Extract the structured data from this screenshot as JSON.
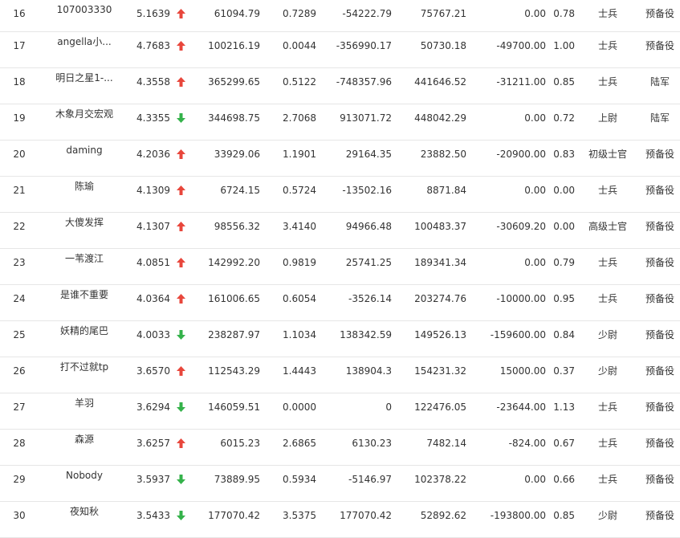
{
  "colors": {
    "up": "#e8463b",
    "down": "#34b24a",
    "text": "#333333",
    "divider": "#e6e6e6"
  },
  "rows": [
    {
      "rank": "16",
      "name": "107003330",
      "score": "5.1639",
      "trend": "up",
      "v1": "61094.79",
      "v2": "0.7289",
      "v3": "-54222.79",
      "v4": "75767.21",
      "v5": "0.00",
      "v6": "0.78",
      "military_rank": "士兵",
      "service": "预备役"
    },
    {
      "rank": "17",
      "name": "angella小...",
      "score": "4.7683",
      "trend": "up",
      "v1": "100216.19",
      "v2": "0.0044",
      "v3": "-356990.17",
      "v4": "50730.18",
      "v5": "-49700.00",
      "v6": "1.00",
      "military_rank": "士兵",
      "service": "预备役"
    },
    {
      "rank": "18",
      "name": "明日之星1-...",
      "score": "4.3558",
      "trend": "up",
      "v1": "365299.65",
      "v2": "0.5122",
      "v3": "-748357.96",
      "v4": "441646.52",
      "v5": "-31211.00",
      "v6": "0.85",
      "military_rank": "士兵",
      "service": "陆军"
    },
    {
      "rank": "19",
      "name": "木象月交宏观",
      "score": "4.3355",
      "trend": "down",
      "v1": "344698.75",
      "v2": "2.7068",
      "v3": "913071.72",
      "v4": "448042.29",
      "v5": "0.00",
      "v6": "0.72",
      "military_rank": "上尉",
      "service": "陆军"
    },
    {
      "rank": "20",
      "name": "daming",
      "score": "4.2036",
      "trend": "up",
      "v1": "33929.06",
      "v2": "1.1901",
      "v3": "29164.35",
      "v4": "23882.50",
      "v5": "-20900.00",
      "v6": "0.83",
      "military_rank": "初级士官",
      "service": "预备役"
    },
    {
      "rank": "21",
      "name": "陈瑜",
      "score": "4.1309",
      "trend": "up",
      "v1": "6724.15",
      "v2": "0.5724",
      "v3": "-13502.16",
      "v4": "8871.84",
      "v5": "0.00",
      "v6": "0.00",
      "military_rank": "士兵",
      "service": "预备役"
    },
    {
      "rank": "22",
      "name": "大傻发挥",
      "score": "4.1307",
      "trend": "up",
      "v1": "98556.32",
      "v2": "3.4140",
      "v3": "94966.48",
      "v4": "100483.37",
      "v5": "-30609.20",
      "v6": "0.00",
      "military_rank": "高级士官",
      "service": "预备役"
    },
    {
      "rank": "23",
      "name": "一苇渡江",
      "score": "4.0851",
      "trend": "up",
      "v1": "142992.20",
      "v2": "0.9819",
      "v3": "25741.25",
      "v4": "189341.34",
      "v5": "0.00",
      "v6": "0.79",
      "military_rank": "士兵",
      "service": "预备役"
    },
    {
      "rank": "24",
      "name": "是谁不重要",
      "score": "4.0364",
      "trend": "up",
      "v1": "161006.65",
      "v2": "0.6054",
      "v3": "-3526.14",
      "v4": "203274.76",
      "v5": "-10000.00",
      "v6": "0.95",
      "military_rank": "士兵",
      "service": "预备役"
    },
    {
      "rank": "25",
      "name": "妖精的尾巴",
      "score": "4.0033",
      "trend": "down",
      "v1": "238287.97",
      "v2": "1.1034",
      "v3": "138342.59",
      "v4": "149526.13",
      "v5": "-159600.00",
      "v6": "0.84",
      "military_rank": "少尉",
      "service": "预备役"
    },
    {
      "rank": "26",
      "name": "打不过就tp",
      "score": "3.6570",
      "trend": "up",
      "v1": "112543.29",
      "v2": "1.4443",
      "v3": "138904.3",
      "v4": "154231.32",
      "v5": "15000.00",
      "v6": "0.37",
      "military_rank": "少尉",
      "service": "预备役"
    },
    {
      "rank": "27",
      "name": "羊羽",
      "score": "3.6294",
      "trend": "down",
      "v1": "146059.51",
      "v2": "0.0000",
      "v3": "0",
      "v4": "122476.05",
      "v5": "-23644.00",
      "v6": "1.13",
      "military_rank": "士兵",
      "service": "预备役"
    },
    {
      "rank": "28",
      "name": "森源",
      "score": "3.6257",
      "trend": "up",
      "v1": "6015.23",
      "v2": "2.6865",
      "v3": "6130.23",
      "v4": "7482.14",
      "v5": "-824.00",
      "v6": "0.67",
      "military_rank": "士兵",
      "service": "预备役"
    },
    {
      "rank": "29",
      "name": "Nobody",
      "score": "3.5937",
      "trend": "down",
      "v1": "73889.95",
      "v2": "0.5934",
      "v3": "-5146.97",
      "v4": "102378.22",
      "v5": "0.00",
      "v6": "0.66",
      "military_rank": "士兵",
      "service": "预备役"
    },
    {
      "rank": "30",
      "name": "夜知秋",
      "score": "3.5433",
      "trend": "down",
      "v1": "177070.42",
      "v2": "3.5375",
      "v3": "177070.42",
      "v4": "52892.62",
      "v5": "-193800.00",
      "v6": "0.85",
      "military_rank": "少尉",
      "service": "预备役"
    }
  ]
}
